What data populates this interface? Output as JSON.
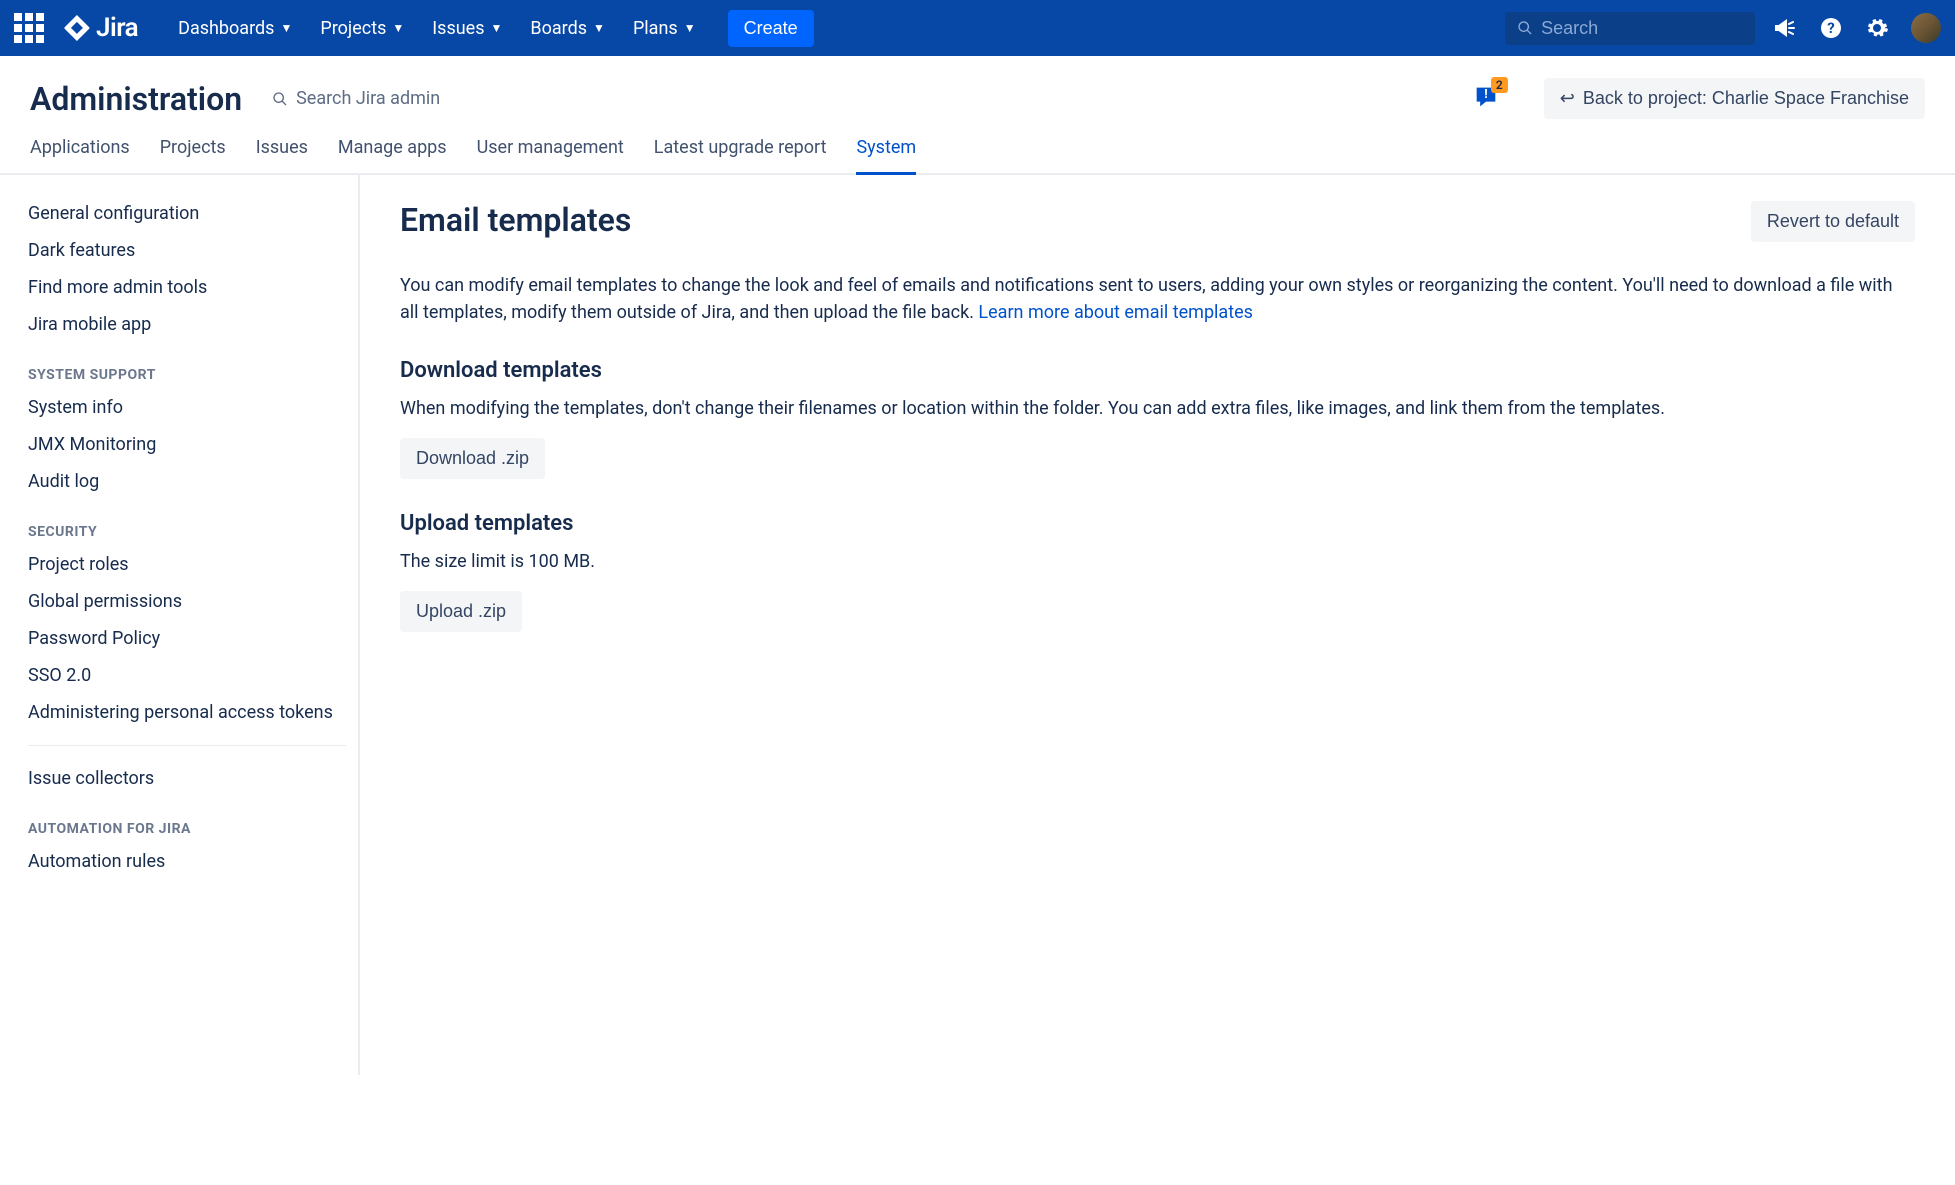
{
  "topnav": {
    "logo_text": "Jira",
    "items": [
      "Dashboards",
      "Projects",
      "Issues",
      "Boards",
      "Plans"
    ],
    "create_label": "Create",
    "search_placeholder": "Search"
  },
  "admin_header": {
    "title": "Administration",
    "search_text": "Search Jira admin",
    "feedback_badge": "2",
    "back_label": "Back to project: Charlie Space Franchise"
  },
  "admin_tabs": [
    "Applications",
    "Projects",
    "Issues",
    "Manage apps",
    "User management",
    "Latest upgrade report",
    "System"
  ],
  "admin_tabs_active_index": 6,
  "sidebar": {
    "top_links": [
      "General configuration",
      "Dark features",
      "Find more admin tools",
      "Jira mobile app"
    ],
    "groups": [
      {
        "heading": "SYSTEM SUPPORT",
        "links": [
          "System info",
          "JMX Monitoring",
          "Audit log"
        ]
      },
      {
        "heading": "SECURITY",
        "links": [
          "Project roles",
          "Global permissions",
          "Password Policy",
          "SSO 2.0",
          "Administering personal access tokens"
        ]
      }
    ],
    "divider_links": [
      "Issue collectors"
    ],
    "groups2": [
      {
        "heading": "AUTOMATION FOR JIRA",
        "links": [
          "Automation rules"
        ]
      }
    ]
  },
  "content": {
    "title": "Email templates",
    "revert_label": "Revert to default",
    "description_text": "You can modify email templates to change the look and feel of emails and notifications sent to users, adding your own styles or reorganizing the content. You'll need to download a file with all templates, modify them outside of Jira, and then upload the file back. ",
    "description_link": "Learn more about email templates",
    "download": {
      "title": "Download templates",
      "desc": "When modifying the templates, don't change their filenames or location within the folder. You can add extra files, like images, and link them from the templates.",
      "button": "Download .zip"
    },
    "upload": {
      "title": "Upload templates",
      "desc": "The size limit is 100 MB.",
      "button": "Upload .zip"
    }
  }
}
